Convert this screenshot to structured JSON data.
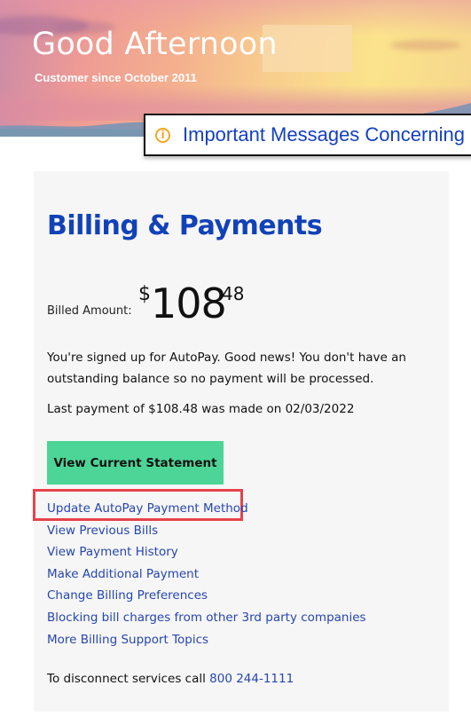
{
  "header": {
    "greeting": "Good Afternoon",
    "customer_since": "Customer since October 2011"
  },
  "message_bar": {
    "icon": "info-icon",
    "icon_glyph": "i",
    "text": "Important Messages Concerning"
  },
  "billing": {
    "title": "Billing & Payments",
    "billed_label": "Billed Amount:",
    "amount": {
      "currency": "$",
      "dollars": "108",
      "cents": "48"
    },
    "autopay_message": "You're signed up for AutoPay. Good news! You don't have an outstanding balance so no payment will be processed.",
    "last_payment": "Last payment of $108.48 was made on 02/03/2022",
    "view_statement_button": "View Current Statement",
    "links": [
      "Update AutoPay Payment Method",
      "View Previous Bills",
      "View Payment History",
      "Make Additional Payment",
      "Change Billing Preferences",
      "Blocking bill charges from other 3rd party companies",
      "More Billing Support Topics"
    ],
    "highlighted_link": "Update AutoPay Payment Method",
    "disconnect_text": "To disconnect services call ",
    "disconnect_phone": "800 244-1111"
  },
  "colors": {
    "brand_blue": "#1142b8",
    "link_blue": "#2646b0",
    "button_green": "#4cd597",
    "highlight_red": "#e8424a",
    "info_orange": "#f5a623",
    "card_bg": "#f6f6f6"
  }
}
